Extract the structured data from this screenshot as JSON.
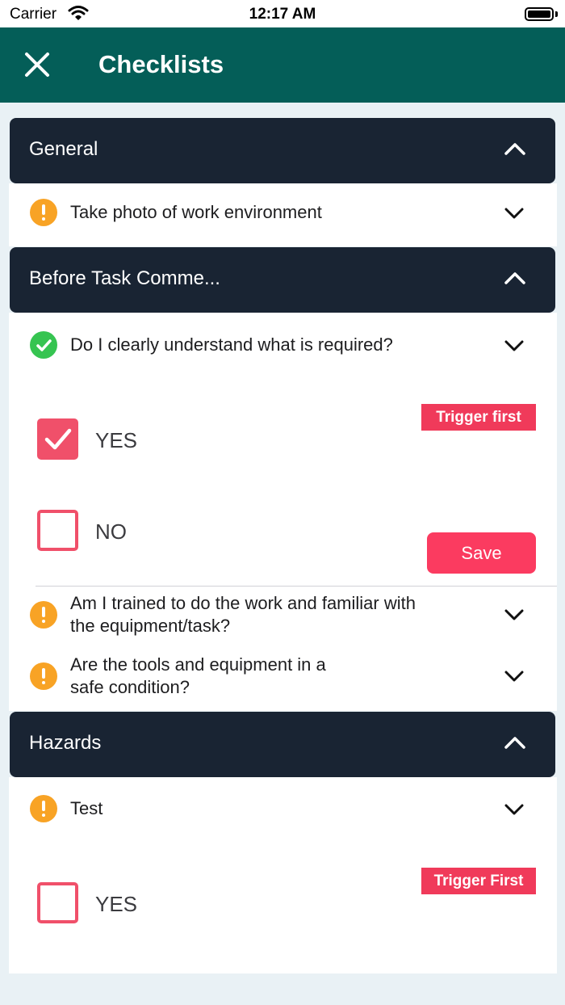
{
  "status_bar": {
    "carrier": "Carrier",
    "time": "12:17 AM"
  },
  "nav": {
    "title": "Checklists",
    "close_icon": "close-icon"
  },
  "sections": [
    {
      "title": "General",
      "items": [
        {
          "status": "warning",
          "text": "Take photo of work environment"
        }
      ]
    },
    {
      "title": "Before Task Comme...",
      "items": [
        {
          "status": "complete",
          "text": "Do I clearly understand what is required?",
          "trigger_label": "Trigger first",
          "options": [
            {
              "label": "YES",
              "checked": true
            },
            {
              "label": "NO",
              "checked": false
            }
          ],
          "save_label": "Save"
        },
        {
          "status": "warning",
          "text_lines": [
            "Am I trained to do the work and familiar with",
            "the equipment/task?"
          ]
        },
        {
          "status": "warning",
          "text_lines": [
            "Are the tools and equipment in a",
            "safe condition?"
          ]
        }
      ]
    },
    {
      "title": "Hazards",
      "items": [
        {
          "status": "warning",
          "text": "Test",
          "trigger_label": "Trigger First",
          "options": [
            {
              "label": "YES",
              "checked": false
            }
          ]
        }
      ]
    }
  ],
  "colors": {
    "nav_bg": "#045e58",
    "section_header_bg": "#192433",
    "warning": "#f8a325",
    "complete": "#36c451",
    "accent": "#f0506a",
    "save_button": "#fb3b60",
    "page_bg": "#e9f1f5"
  }
}
